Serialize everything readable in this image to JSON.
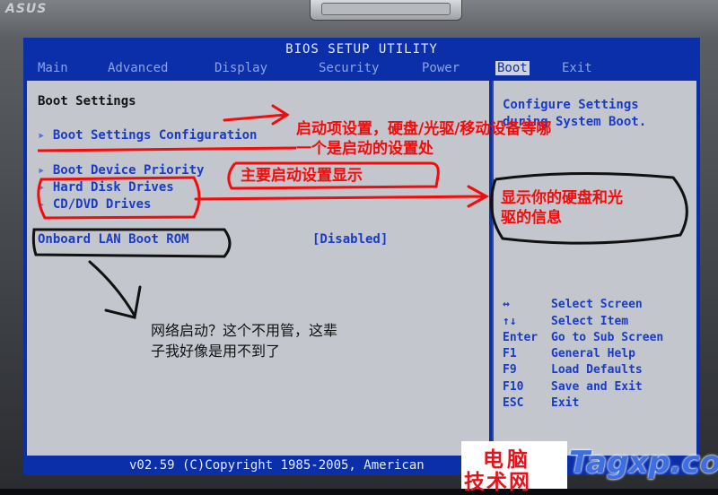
{
  "bezel": {
    "logo_text": "ASUS"
  },
  "bios": {
    "title": "BIOS SETUP UTILITY",
    "menu": [
      "Main",
      "Advanced",
      "Display",
      "Security",
      "Power",
      "Boot",
      "Exit"
    ],
    "active_menu": "Boot",
    "section_title": "Boot Settings",
    "items": {
      "boot_settings_config": "Boot Settings Configuration",
      "boot_device_priority": "Boot Device Priority",
      "hard_disk_drives": "Hard Disk Drives",
      "cd_dvd_drives": "CD/DVD Drives",
      "onboard_lan_label": "Onboard LAN Boot ROM",
      "onboard_lan_value": "[Disabled]"
    },
    "help": {
      "line1": "Configure Settings",
      "line2": "during System Boot."
    },
    "keys": [
      {
        "key": "↔",
        "action": "Select Screen"
      },
      {
        "key": "↑↓",
        "action": "Select Item"
      },
      {
        "key": "Enter",
        "action": "Go to Sub Screen"
      },
      {
        "key": "F1",
        "action": "General Help"
      },
      {
        "key": "F9",
        "action": "Load Defaults"
      },
      {
        "key": "F10",
        "action": "Save and Exit"
      },
      {
        "key": "ESC",
        "action": "Exit"
      }
    ],
    "footer": "v02.59 (C)Copyright 1985-2005, American"
  },
  "annotations": {
    "boot_config_line1": "启动项设置，硬盘/光驱/移动设备等哪",
    "boot_config_line2": "一个是启动的设置处",
    "priority_note": "主要启动设置显示",
    "drives_note_line1": "显示你的硬盘和光",
    "drives_note_line2": "驱的信息",
    "lan_note_line1": "网络启动？这个不用管，这辈",
    "lan_note_line2": "子我好像是用不到了"
  },
  "watermark": {
    "cn_line1": "电脑",
    "cn_line2": "技术网",
    "site": "Tagxp.com"
  },
  "colors": {
    "bios_blue": "#0a2fa8",
    "panel_gray": "#c3c6cc",
    "annotation_red": "#f40b0b"
  }
}
